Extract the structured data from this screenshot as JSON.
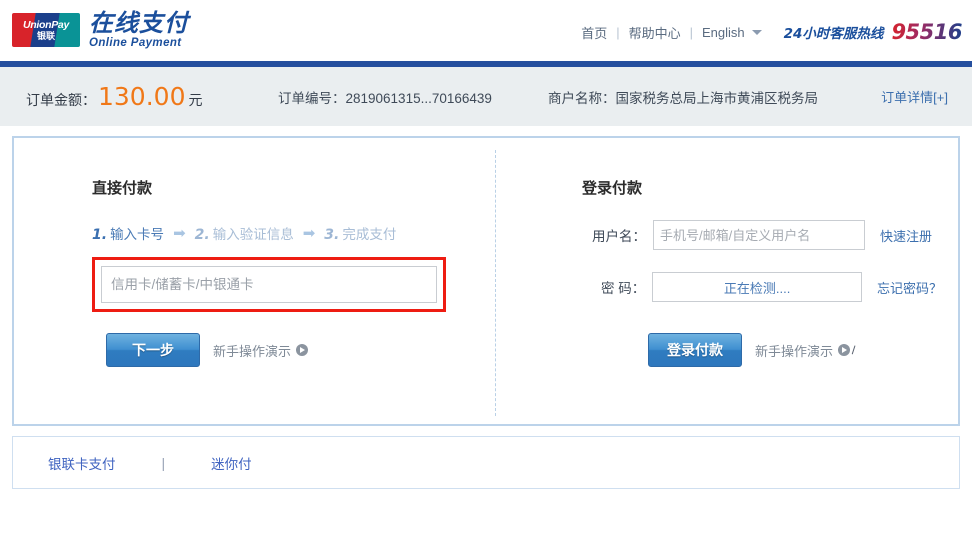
{
  "header": {
    "logo": {
      "mark_line1": "UnionPay",
      "mark_line2": "银联",
      "brand_cn": "在线支付",
      "brand_en": "Online  Payment"
    },
    "nav": {
      "home": "首页",
      "sep1": "|",
      "help": "帮助中心",
      "sep2": "|",
      "language": "English",
      "hotline_label": "24小时客服热线",
      "hotline_number": "95516"
    },
    "accent_bar_color": "#254f9e"
  },
  "order_bar": {
    "amount_label": "订单金额：",
    "amount_value": "130.00",
    "amount_unit": "元",
    "amount_color": "#f07818",
    "order_no": "订单编号：2819061315...70166439",
    "merchant": "商户名称：国家税务总局上海市黄浦区税务局",
    "detail_link": "订单详情[+]",
    "background": "#eaeef0"
  },
  "direct_pay": {
    "title": "直接付款",
    "steps": [
      {
        "num": "1.",
        "label": "输入卡号",
        "state": "active"
      },
      {
        "num": "2.",
        "label": "输入验证信息",
        "state": "idle"
      },
      {
        "num": "3.",
        "label": "完成支付",
        "state": "idle"
      }
    ],
    "arrow_glyph": "➡",
    "card_input": {
      "placeholder": "信用卡/储蓄卡/中银通卡",
      "value": "",
      "highlight_color": "#ee1c12"
    },
    "next_button": "下一步",
    "demo_link": "新手操作演示"
  },
  "login_pay": {
    "title": "登录付款",
    "username": {
      "label": "用户名：",
      "placeholder": "手机号/邮箱/自定义用户名",
      "value": "",
      "side_link": "快速注册"
    },
    "password": {
      "label": "密 码：",
      "value": "正在检测....",
      "side_link": "忘记密码？"
    },
    "login_button": "登录付款",
    "demo_link": "新手操作演示"
  },
  "footer": {
    "tab_unionpay": "银联卡支付",
    "separator": "|",
    "tab_minipay": "迷你付"
  }
}
